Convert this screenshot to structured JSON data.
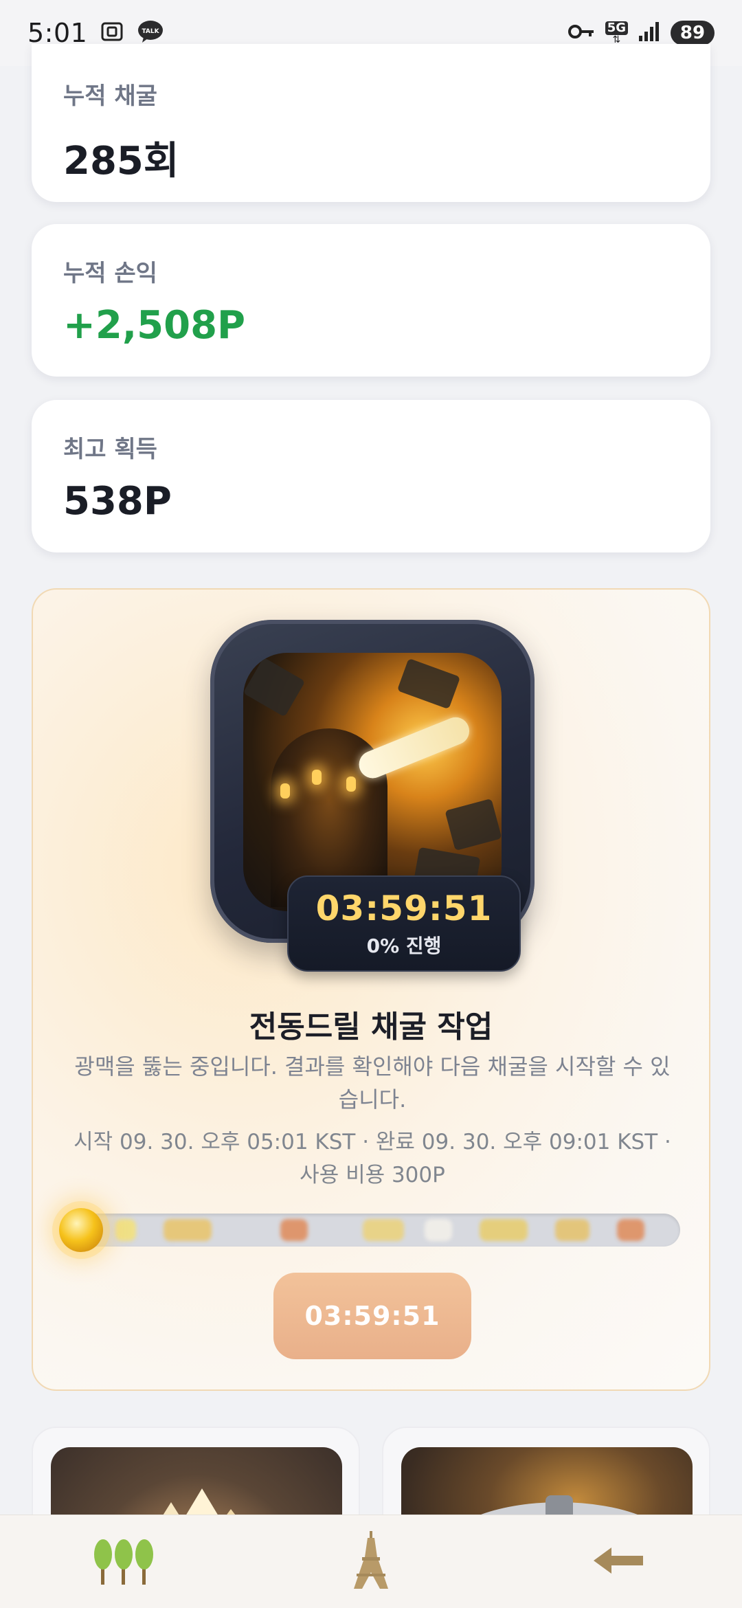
{
  "status_bar": {
    "time": "5:01",
    "network": "5G",
    "battery": "89"
  },
  "stats": [
    {
      "label": "누적 채굴",
      "value": "285회"
    },
    {
      "label": "누적 손익",
      "value": "+2,508P"
    },
    {
      "label": "최고 획득",
      "value": "538P"
    }
  ],
  "mining": {
    "timer": "03:59:51",
    "progress_text": "0% 진행",
    "progress_fraction": 0.0,
    "title": "전동드릴 채굴 작업",
    "description": "광맥을 뚫는 중입니다. 결과를 확인해야 다음 채굴을 시작할 수 있습니다.",
    "meta": "시작 09. 30. 오후 05:01 KST · 완료 09. 30. 오후 09:01 KST · 사용 비용 300P",
    "button_label": "03:59:51"
  },
  "bottom_nav": {
    "items": [
      {
        "icon": "trees-icon"
      },
      {
        "icon": "tower-icon"
      },
      {
        "icon": "back-arrow-icon"
      }
    ]
  },
  "colors": {
    "positive": "#21a04b",
    "accent_gold": "#ffd66b",
    "button": "#e9b08a"
  }
}
